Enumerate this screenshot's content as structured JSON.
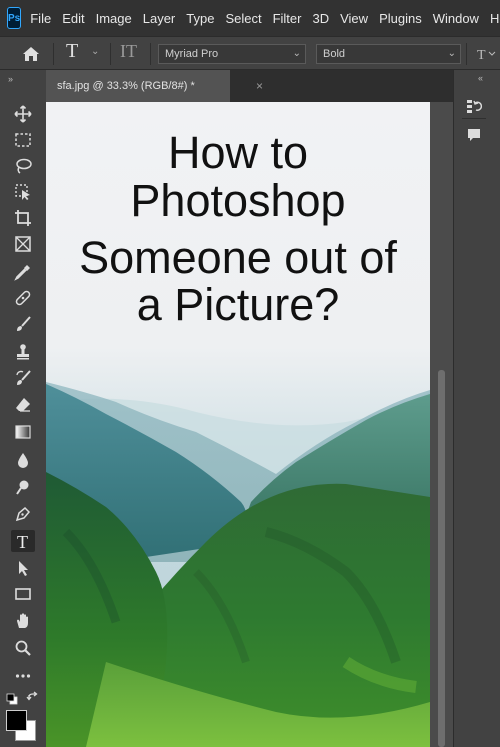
{
  "app": {
    "logo_text": "Ps"
  },
  "menu": [
    "File",
    "Edit",
    "Image",
    "Layer",
    "Type",
    "Select",
    "Filter",
    "3D",
    "View",
    "Plugins",
    "Window",
    "He"
  ],
  "options_bar": {
    "tool_glyph": "T",
    "orientation_glyph": "IT",
    "font_family": "Myriad Pro",
    "font_style": "Bold"
  },
  "document": {
    "tab_label": "sfa.jpg @ 33.3% (RGB/8#) *",
    "close_glyph": "×",
    "title_lines": [
      "How to",
      "Photoshop",
      "Someone out of",
      "a Picture?"
    ]
  },
  "toolbar": {
    "tools": [
      "move-icon",
      "marquee-icon",
      "lasso-icon",
      "object-select-icon",
      "crop-icon",
      "frame-icon",
      "eyedropper-icon",
      "healing-brush-icon",
      "brush-icon",
      "clone-stamp-icon",
      "history-brush-icon",
      "eraser-icon",
      "gradient-icon",
      "blur-icon",
      "dodge-icon",
      "pen-icon",
      "type-icon",
      "path-select-icon",
      "rectangle-icon",
      "hand-icon",
      "zoom-icon",
      "more-tools-icon"
    ],
    "active_tool": "type-icon",
    "foreground_color": "#000000",
    "background_color": "#ffffff"
  },
  "colors": {
    "menubar": "#323232",
    "panel": "#424242",
    "workspace": "#535353",
    "accent": "#31a8ff"
  }
}
